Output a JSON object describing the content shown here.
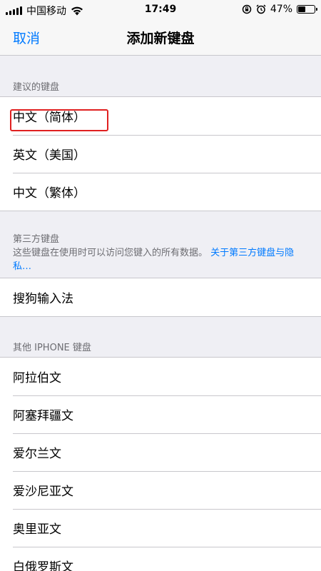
{
  "status_bar": {
    "carrier": "中国移动",
    "time": "17:49",
    "battery": "47%",
    "battery_level": 0.47,
    "icons": [
      "signal-icon",
      "wifi-icon",
      "orientation-lock-icon",
      "alarm-icon",
      "battery-icon"
    ]
  },
  "nav": {
    "cancel_label": "取消",
    "title": "添加新键盘"
  },
  "sections": {
    "suggested": {
      "header": "建议的键盘",
      "items": [
        "中文（简体）",
        "英文（美国）",
        "中文（繁体）"
      ]
    },
    "third_party": {
      "header": "第三方键盘",
      "description": "这些键盘在使用时可以访问您键入的所有数据。",
      "link": "关于第三方键盘与隐私…",
      "items": [
        "搜狗输入法"
      ]
    },
    "other": {
      "header": "其他 IPHONE 键盘",
      "items": [
        "阿拉伯文",
        "阿塞拜疆文",
        "爱尔兰文",
        "爱沙尼亚文",
        "奥里亚文",
        "白俄罗斯文"
      ]
    }
  },
  "colors": {
    "accent": "#007aff",
    "background": "#efeff4",
    "highlight": "#e02020"
  }
}
